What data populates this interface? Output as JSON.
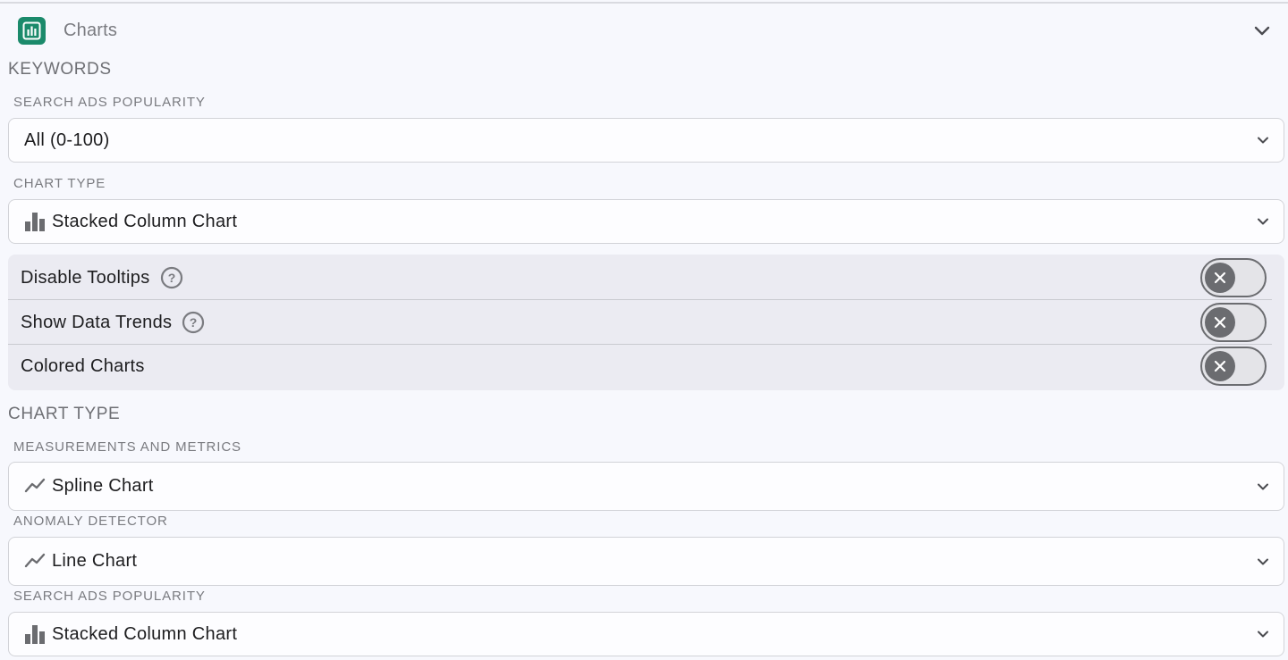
{
  "header": {
    "title": "Charts",
    "icon": "bar-chart-icon",
    "accent": "#1b8a6b"
  },
  "keywords": {
    "section_title": "KEYWORDS",
    "popularity": {
      "label": "SEARCH ADS POPULARITY",
      "value": "All (0-100)"
    },
    "chart_type": {
      "label": "CHART TYPE",
      "value": "Stacked Column Chart",
      "icon": "column-chart-icon"
    },
    "toggles": [
      {
        "label": "Disable Tooltips",
        "help": true,
        "on": false
      },
      {
        "label": "Show Data Trends",
        "help": true,
        "on": false
      },
      {
        "label": "Colored Charts",
        "help": false,
        "on": false
      }
    ]
  },
  "chart_types": {
    "section_title": "CHART TYPE",
    "fields": [
      {
        "label": "MEASUREMENTS AND METRICS",
        "value": "Spline Chart",
        "icon": "line-chart-icon"
      },
      {
        "label": "ANOMALY DETECTOR",
        "value": "Line Chart",
        "icon": "line-chart-icon"
      },
      {
        "label": "SEARCH ADS POPULARITY",
        "value": "Stacked Column Chart",
        "icon": "column-chart-icon"
      }
    ]
  }
}
